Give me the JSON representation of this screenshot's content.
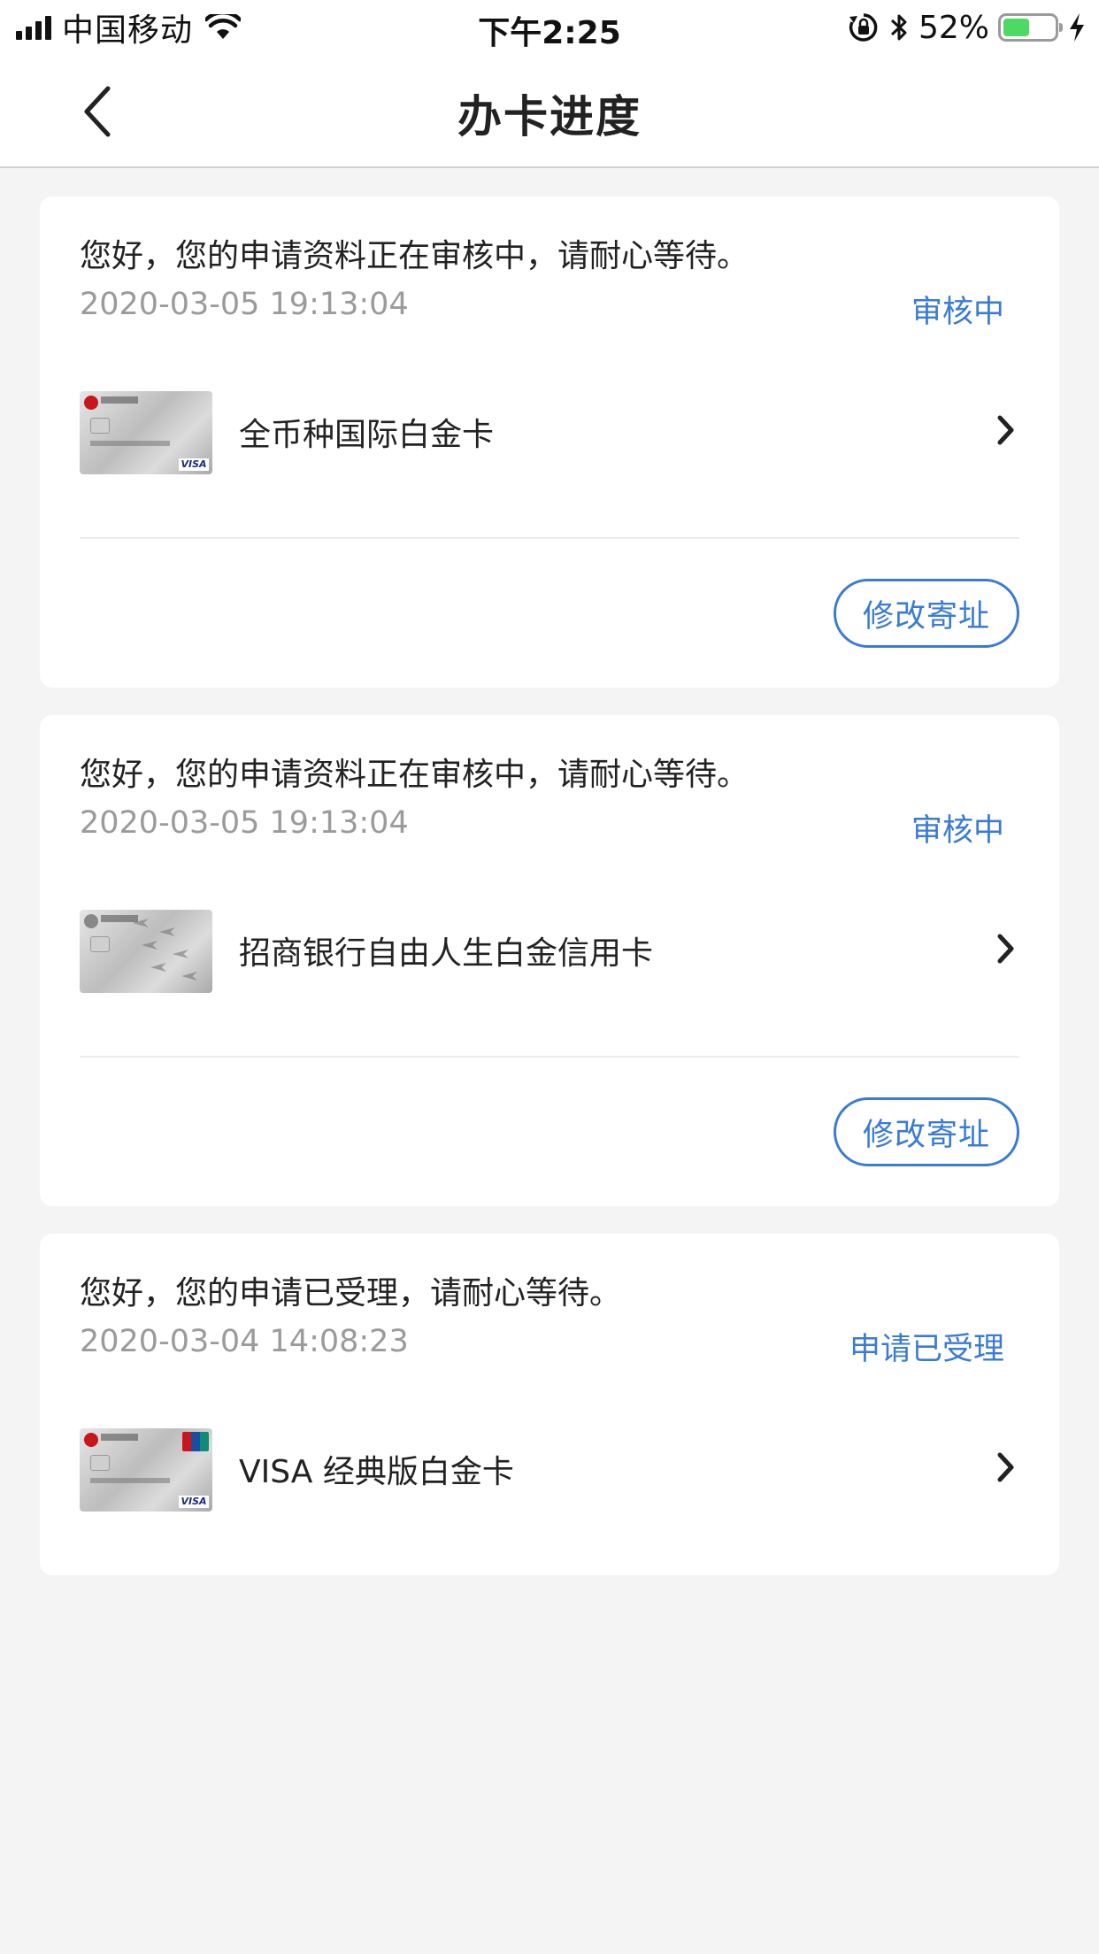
{
  "status_bar": {
    "carrier": "中国移动",
    "time": "下午2:25",
    "battery_percent": "52%",
    "battery_level": 0.52,
    "icons": [
      "signal-icon",
      "wifi-icon",
      "rotation-lock-icon",
      "bluetooth-icon",
      "battery-icon",
      "charging-icon"
    ]
  },
  "nav": {
    "title": "办卡进度",
    "back_icon": "chevron-left-icon"
  },
  "colors": {
    "accent": "#3a7bd5",
    "background": "#f4f4f4",
    "secondary_text": "#9b9b9b"
  },
  "applications": [
    {
      "message": "您好，您的申请资料正在审核中，请耐心等待。",
      "timestamp": "2020-03-05 19:13:04",
      "status": "审核中",
      "card_name": "全币种国际白金卡",
      "action_label": "修改寄址"
    },
    {
      "message": "您好，您的申请资料正在审核中，请耐心等待。",
      "timestamp": "2020-03-05 19:13:04",
      "status": "审核中",
      "card_name": "招商银行自由人生白金信用卡",
      "action_label": "修改寄址"
    },
    {
      "message": "您好，您的申请已受理，请耐心等待。",
      "timestamp": "2020-03-04 14:08:23",
      "status": "申请已受理",
      "card_name": "VISA 经典版白金卡"
    }
  ]
}
